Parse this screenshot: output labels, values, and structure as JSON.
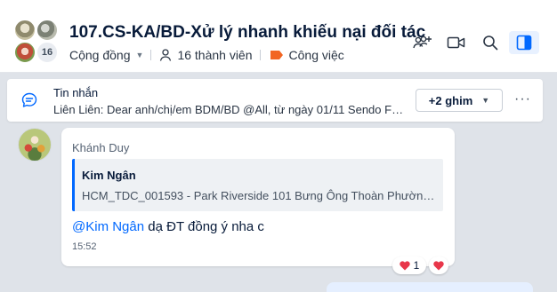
{
  "header": {
    "title": "107.CS-KA/BD-Xử lý nhanh khiếu nại đối tác",
    "member_avatar_count": "16",
    "community_label": "Cộng đồng",
    "members_label": "16 thành viên",
    "tag_label": "Công việc",
    "tag_color": "#f26522",
    "icons": [
      "add-member-icon",
      "video-call-icon",
      "search-icon",
      "conversation-info-icon"
    ]
  },
  "pinned": {
    "title": "Tin nhắn",
    "text": "Liên Liên: Dear anh/chị/em BDM/BD @All, từ ngày 01/11 Sendo Far...",
    "more_label": "+2 ghim",
    "menu_label": "···"
  },
  "message": {
    "sender": "Khánh Duy",
    "quote": {
      "name": "Kim Ngân",
      "text": "HCM_TDC_001593 - Park Riverside 101 Bưng Ông Thoàn Phường P..."
    },
    "mention": "@Kim Ngân",
    "text": " dạ ĐT đồng ý nha c",
    "time": "15:52",
    "reaction_count": "1"
  },
  "colors": {
    "accent": "#0068ff",
    "heart": "#e8374a",
    "background": "#dfe3e9"
  }
}
